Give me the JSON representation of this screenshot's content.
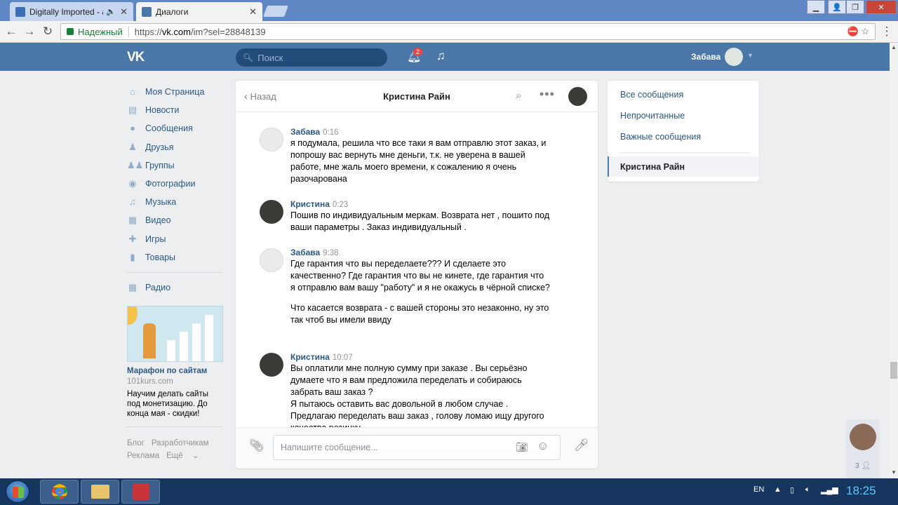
{
  "browser": {
    "tabs": [
      {
        "title": "Digitally Imported - a",
        "audio_icon": "speaker-icon"
      },
      {
        "title": "Диалоги"
      }
    ],
    "secure_label": "Надежный",
    "url_prefix": "https://",
    "url_host": "vk.com",
    "url_path": "/im?sel=28848139"
  },
  "header": {
    "logo": "VK",
    "search_placeholder": "Поиск",
    "notifications_count": "2",
    "username": "Забава"
  },
  "left_menu": {
    "items": [
      {
        "label": "Моя Страница",
        "icon": "home-icon"
      },
      {
        "label": "Новости",
        "icon": "news-icon"
      },
      {
        "label": "Сообщения",
        "icon": "chat-icon"
      },
      {
        "label": "Друзья",
        "icon": "person-icon"
      },
      {
        "label": "Группы",
        "icon": "group-icon"
      },
      {
        "label": "Фотографии",
        "icon": "camera-icon"
      },
      {
        "label": "Музыка",
        "icon": "music-icon"
      },
      {
        "label": "Видео",
        "icon": "video-icon"
      },
      {
        "label": "Игры",
        "icon": "gamepad-icon"
      },
      {
        "label": "Товары",
        "icon": "bag-icon"
      }
    ],
    "extra": {
      "label": "Радио",
      "icon": "grid-icon"
    }
  },
  "ad": {
    "title": "Марафон по сайтам",
    "site": "101kurs.com",
    "text": "Научим делать сайты под монетизацию. До конца мая - скидки!"
  },
  "footer_links": [
    "Блог",
    "Разработчикам",
    "Реклама",
    "Ещё"
  ],
  "chat": {
    "back_label": "Назад",
    "title": "Кристина Райн",
    "messages": [
      {
        "author": "Забава",
        "time": "0:16",
        "paragraphs": [
          "я подумала, решила что все таки я вам отправлю этот заказ, и попрошу вас вернуть мне деньги, т.к. не уверена в вашей работе, мне жаль моего времени, к сожалению я очень разочарована"
        ]
      },
      {
        "author": "Кристина",
        "time": "0:23",
        "paragraphs": [
          "Пошив по индивидуальным меркам. Возврата нет , пошито под ваши параметры . Заказ индивидуальный ."
        ]
      },
      {
        "author": "Забава",
        "time": "9:38",
        "paragraphs": [
          "Где гарантия что вы переделаете??? И сделаете это качественно? Где гарантия что вы не кинете, где гарантия что я отправлю вам вашу \"работу\" и я не окажусь в чёрной списке?",
          "Что касается возврата - с вашей стороны это незаконно, ну это так чтоб вы имели ввиду"
        ]
      },
      {
        "author": "Кристина",
        "time": "10:07",
        "paragraphs": [
          "Вы оплатили мне полную сумму при заказе . Вы серьёзно думаете что я вам предложила переделать и собираюсь забрать ваш заказ ?\nЯ пытаюсь оставить вас довольной в любом случае .\nПредлагаю переделать ваш заказ , голову ломаю ищу другого качества резинку"
        ]
      }
    ],
    "compose_placeholder": "Напишите сообщение..."
  },
  "right_panel": {
    "items": [
      "Все сообщения",
      "Непрочитанные",
      "Важные сообщения"
    ],
    "active": "Кристина Райн"
  },
  "widget": {
    "count": "3"
  },
  "taskbar": {
    "lang": "EN",
    "time": "18:25"
  }
}
